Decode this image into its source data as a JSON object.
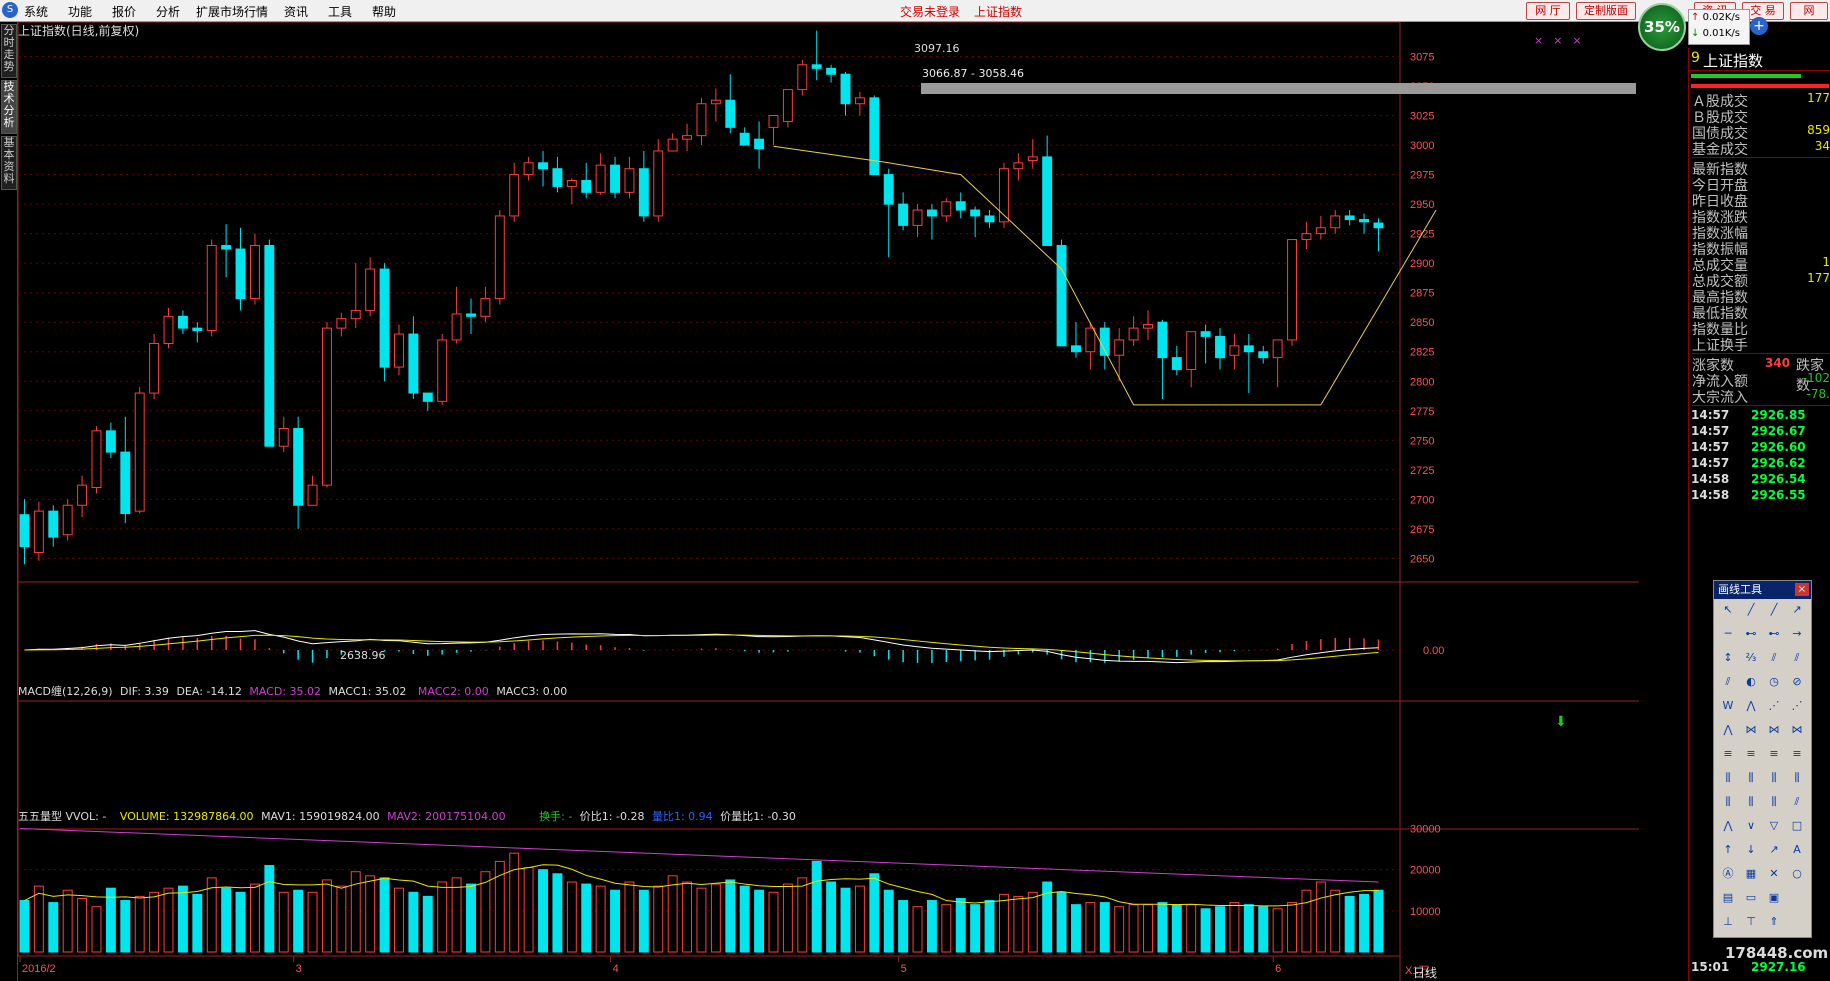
{
  "menu": {
    "items": [
      "系统",
      "功能",
      "报价",
      "分析",
      "扩展市场行情",
      "资讯",
      "工具",
      "帮助"
    ],
    "alert": "交易未登录",
    "title": "上证指数",
    "right_buttons": [
      "网 厅",
      "定制版面",
      "资 讯",
      "交 易",
      "网"
    ]
  },
  "speed": {
    "percent": "35%",
    "up": "0.02K/s",
    "down": "0.01K/s"
  },
  "left_tabs": [
    {
      "label": "分时走势",
      "active": false
    },
    {
      "label": "技术分析",
      "active": true
    },
    {
      "label": "基本资料",
      "active": false
    }
  ],
  "colors": {
    "up": "#ff3c3c",
    "down": "#00e5ee",
    "grid": "#6b0000",
    "axis": "#9b2222"
  },
  "main_panel": {
    "title": "上证指数(日线,前复权)",
    "high_label": "3097.16",
    "low_label": "2638.96",
    "range_label": "3066.87 - 3058.46",
    "price_ticks": [
      "3075",
      "3050",
      "3025",
      "3000",
      "2975",
      "2950",
      "2925",
      "2900",
      "2875",
      "2850",
      "2825",
      "2800",
      "2775",
      "2750",
      "2725",
      "2700",
      "2675",
      "2650"
    ]
  },
  "macd_panel": {
    "name": "MACD缠(12,26,9)",
    "dif": "DIF: 3.39",
    "dea": "DEA: -14.12",
    "macd": "MACD: 35.02",
    "macc1": "MACC1: 35.02",
    "macc2": "MACC2: 0.00",
    "macc3": "MACC3: 0.00",
    "zero_tick": "0.00"
  },
  "vol_panel": {
    "name": "五五量型 VVOL: -",
    "volume": "VOLUME: 132987864.00",
    "mav1": "MAV1: 159019824.00",
    "mav2": "MAV2: 200175104.00",
    "turnover": "换手: -",
    "price_ratio": "价比1: -0.28",
    "vol_ratio": "量比1: 0.94",
    "pv_ratio": "价量比1: -0.30",
    "ticks": [
      "30000",
      "20000",
      "10000"
    ],
    "unit": "X1万"
  },
  "x_axis": {
    "labels": [
      "2016/2",
      "3",
      "4",
      "5",
      "6"
    ],
    "period": "日线"
  },
  "chart_data": {
    "type": "candlestick",
    "title": "上证指数(日线,前复权)",
    "ylim": [
      2630,
      3100
    ],
    "y_ticks": [
      2650,
      2675,
      2700,
      2725,
      2750,
      2775,
      2800,
      2825,
      2850,
      2875,
      2900,
      2925,
      2950,
      2975,
      3000,
      3025,
      3050,
      3075
    ],
    "month_labels": [
      "2016/2",
      "3",
      "4",
      "5",
      "6"
    ],
    "high_point": 3097.16,
    "low_point": 2638.96,
    "ohlc": [
      [
        2687,
        2700,
        2645,
        2660
      ],
      [
        2655,
        2698,
        2648,
        2690
      ],
      [
        2690,
        2695,
        2660,
        2668
      ],
      [
        2670,
        2700,
        2665,
        2695
      ],
      [
        2695,
        2720,
        2685,
        2712
      ],
      [
        2710,
        2762,
        2705,
        2758
      ],
      [
        2758,
        2765,
        2735,
        2740
      ],
      [
        2740,
        2770,
        2680,
        2688
      ],
      [
        2690,
        2795,
        2688,
        2790
      ],
      [
        2790,
        2840,
        2785,
        2832
      ],
      [
        2832,
        2862,
        2828,
        2855
      ],
      [
        2855,
        2860,
        2840,
        2845
      ],
      [
        2845,
        2850,
        2833,
        2843
      ],
      [
        2843,
        2920,
        2838,
        2915
      ],
      [
        2915,
        2933,
        2888,
        2912
      ],
      [
        2912,
        2930,
        2860,
        2870
      ],
      [
        2870,
        2925,
        2865,
        2915
      ],
      [
        2915,
        2920,
        2745,
        2745
      ],
      [
        2745,
        2770,
        2740,
        2760
      ],
      [
        2760,
        2770,
        2675,
        2695
      ],
      [
        2695,
        2720,
        2695,
        2712
      ],
      [
        2712,
        2850,
        2710,
        2845
      ],
      [
        2845,
        2858,
        2838,
        2853
      ],
      [
        2853,
        2900,
        2845,
        2860
      ],
      [
        2860,
        2905,
        2855,
        2895
      ],
      [
        2895,
        2900,
        2800,
        2812
      ],
      [
        2812,
        2848,
        2805,
        2840
      ],
      [
        2840,
        2855,
        2785,
        2790
      ],
      [
        2790,
        2790,
        2775,
        2783
      ],
      [
        2783,
        2840,
        2780,
        2835
      ],
      [
        2835,
        2880,
        2832,
        2857
      ],
      [
        2857,
        2870,
        2840,
        2855
      ],
      [
        2855,
        2880,
        2850,
        2870
      ],
      [
        2870,
        2945,
        2865,
        2940
      ],
      [
        2940,
        2985,
        2935,
        2975
      ],
      [
        2975,
        2990,
        2970,
        2985
      ],
      [
        2985,
        2995,
        2965,
        2980
      ],
      [
        2980,
        2990,
        2960,
        2965
      ],
      [
        2965,
        2972,
        2950,
        2970
      ],
      [
        2970,
        2985,
        2955,
        2960
      ],
      [
        2960,
        2993,
        2958,
        2983
      ],
      [
        2983,
        2990,
        2955,
        2960
      ],
      [
        2960,
        2990,
        2955,
        2980
      ],
      [
        2980,
        2995,
        2935,
        2940
      ],
      [
        2940,
        3005,
        2935,
        2995
      ],
      [
        2995,
        3010,
        2998,
        3005
      ],
      [
        3005,
        3018,
        2995,
        3008
      ],
      [
        3008,
        3040,
        3000,
        3035
      ],
      [
        3035,
        3048,
        3020,
        3038
      ],
      [
        3038,
        3060,
        3010,
        3015
      ],
      [
        3010,
        3015,
        3000,
        3000
      ],
      [
        3005,
        3020,
        2980,
        2997
      ],
      [
        3015,
        3025,
        3000,
        3025
      ],
      [
        3020,
        3045,
        3015,
        3047
      ],
      [
        3047,
        3072,
        3042,
        3068
      ],
      [
        3068,
        3097,
        3055,
        3065
      ],
      [
        3065,
        3068,
        3053,
        3060
      ],
      [
        3060,
        3062,
        3025,
        3035
      ],
      [
        3035,
        3045,
        3025,
        3040
      ],
      [
        3040,
        3042,
        2980,
        2975
      ],
      [
        2975,
        2980,
        2905,
        2950
      ],
      [
        2950,
        2960,
        2928,
        2932
      ],
      [
        2932,
        2950,
        2922,
        2945
      ],
      [
        2945,
        2950,
        2920,
        2940
      ],
      [
        2940,
        2955,
        2935,
        2952
      ],
      [
        2952,
        2960,
        2938,
        2945
      ],
      [
        2945,
        2948,
        2922,
        2940
      ],
      [
        2940,
        2945,
        2930,
        2935
      ],
      [
        2935,
        2985,
        2930,
        2980
      ],
      [
        2980,
        2993,
        2970,
        2985
      ],
      [
        2987,
        3005,
        2980,
        2990
      ],
      [
        2990,
        3008,
        2915,
        2915
      ],
      [
        2915,
        2920,
        2830,
        2830
      ],
      [
        2830,
        2850,
        2820,
        2825
      ],
      [
        2825,
        2850,
        2810,
        2845
      ],
      [
        2845,
        2850,
        2810,
        2822
      ],
      [
        2822,
        2845,
        2800,
        2835
      ],
      [
        2835,
        2855,
        2830,
        2845
      ],
      [
        2845,
        2860,
        2835,
        2848
      ],
      [
        2850,
        2852,
        2785,
        2820
      ],
      [
        2820,
        2830,
        2805,
        2810
      ],
      [
        2810,
        2840,
        2795,
        2842
      ],
      [
        2842,
        2848,
        2815,
        2838
      ],
      [
        2838,
        2845,
        2810,
        2820
      ],
      [
        2822,
        2840,
        2810,
        2830
      ],
      [
        2830,
        2840,
        2790,
        2825
      ],
      [
        2825,
        2830,
        2815,
        2820
      ],
      [
        2820,
        2830,
        2795,
        2835
      ],
      [
        2835,
        2920,
        2830,
        2920
      ],
      [
        2920,
        2935,
        2912,
        2925
      ],
      [
        2925,
        2940,
        2920,
        2930
      ],
      [
        2930,
        2945,
        2925,
        2940
      ],
      [
        2940,
        2945,
        2932,
        2937
      ],
      [
        2937,
        2942,
        2925,
        2935
      ],
      [
        2934,
        2938,
        2910,
        2930
      ]
    ],
    "volume_wan": [
      12500,
      16000,
      12000,
      15000,
      13000,
      11000,
      15500,
      12500,
      13500,
      14500,
      15500,
      16000,
      14000,
      18000,
      15500,
      14500,
      16500,
      21000,
      14500,
      15000,
      14500,
      17500,
      16000,
      19500,
      18500,
      18000,
      15500,
      14500,
      13500,
      17000,
      18000,
      16500,
      19500,
      22000,
      24000,
      20500,
      20000,
      19000,
      17000,
      16500,
      16000,
      15000,
      17000,
      15000,
      16000,
      18500,
      17000,
      15500,
      16500,
      17500,
      16000,
      15000,
      14500,
      16500,
      18000,
      22000,
      17000,
      15500,
      16000,
      19000,
      15000,
      12500,
      11000,
      12500,
      11500,
      13000,
      11500,
      12500,
      14000,
      13500,
      14500,
      17000,
      14500,
      11500,
      12000,
      12000,
      11000,
      11500,
      11500,
      12000,
      11500,
      11500,
      10500,
      11000,
      12000,
      11500,
      11000,
      10500,
      12000,
      15000,
      17000,
      15000,
      13500,
      14000,
      15000
    ],
    "mav1_wan": 15902,
    "mav2_wan": 20018
  }
}
